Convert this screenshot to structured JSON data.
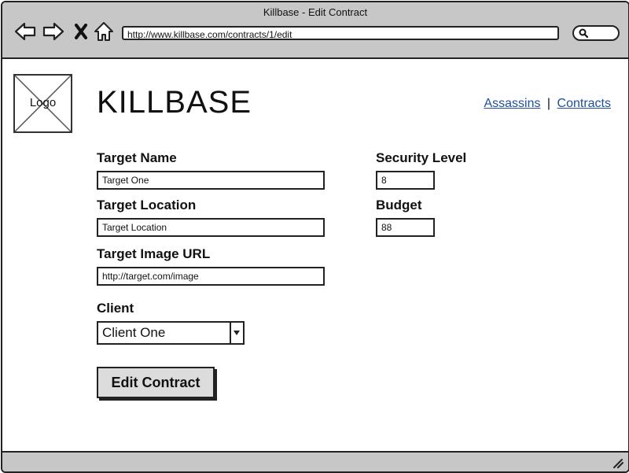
{
  "window": {
    "title": "Killbase - Edit Contract"
  },
  "browser": {
    "url": "http://www.killbase.com/contracts/1/edit",
    "icons": [
      "back-arrow-icon",
      "forward-arrow-icon",
      "close-x-icon",
      "home-icon",
      "search-icon"
    ]
  },
  "header": {
    "logo_text": "Logo",
    "app_title": "KILLBASE",
    "nav": [
      {
        "label": "Assassins"
      },
      {
        "label": "Contracts"
      }
    ],
    "nav_separator": "|",
    "link_color": "#1f4e9c"
  },
  "form": {
    "target_name": {
      "label": "Target Name",
      "value": "Target One"
    },
    "target_location": {
      "label": "Target Location",
      "value": "Target Location"
    },
    "target_image_url": {
      "label": "Target Image URL",
      "value": "http://target.com/image"
    },
    "client": {
      "label": "Client",
      "value": "Client One"
    },
    "security_level": {
      "label": "Security Level",
      "value": "8"
    },
    "budget": {
      "label": "Budget",
      "value": "88"
    },
    "submit_label": "Edit Contract"
  }
}
